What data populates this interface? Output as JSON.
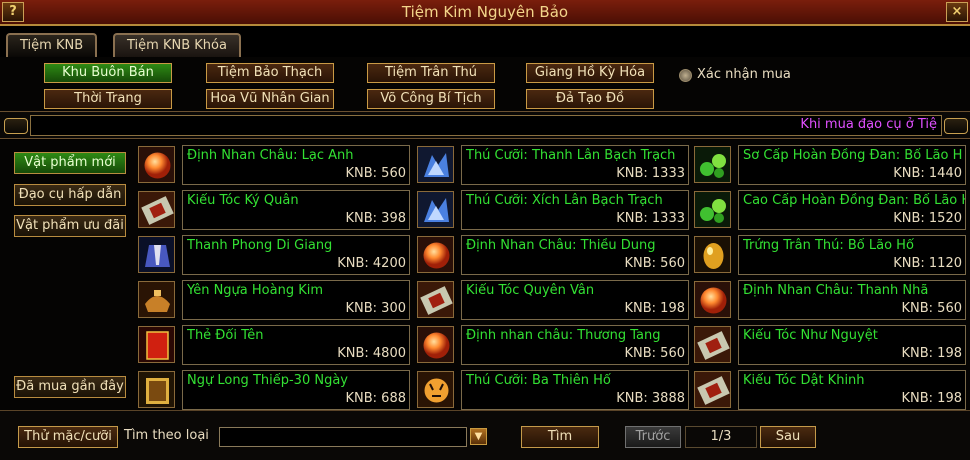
{
  "window": {
    "title": "Tiệm Kim Nguyên Bảo",
    "help_icon": "?",
    "close_icon": "×"
  },
  "tabs": [
    {
      "label": "Tiệm KNB",
      "active": true
    },
    {
      "label": "Tiệm KNB Khóa",
      "active": false
    }
  ],
  "categories": [
    {
      "label": "Khu Buôn Bán",
      "active": true
    },
    {
      "label": "Tiệm Bảo Thạch",
      "active": false
    },
    {
      "label": "Tiệm Trân Thú",
      "active": false
    },
    {
      "label": "Giang Hồ Kỳ Hóa",
      "active": false
    },
    {
      "label": "Thời Trang",
      "active": false
    },
    {
      "label": "Hoa Vũ Nhân Gian",
      "active": false
    },
    {
      "label": "Võ Công Bí Tịch",
      "active": false
    },
    {
      "label": "Đả Tạo Đồ",
      "active": false
    }
  ],
  "confirm_purchase": {
    "label": "Xác nhận mua",
    "checked": false
  },
  "marquee": "Khi mua đạo cụ ở Tiệ",
  "sidebar": [
    {
      "label": "Vật phẩm mới",
      "active": true
    },
    {
      "label": "Đạo cụ hấp dẫn",
      "active": false
    },
    {
      "label": "Vật phẩm ưu đãi",
      "active": false
    },
    {
      "label": "Đã mua gần đây",
      "active": false
    }
  ],
  "items": [
    {
      "name": "Định Nhan Châu: Lạc Anh",
      "price": "KNB: 560",
      "icon": "orb-icon"
    },
    {
      "name": "Thú Cưỡi: Thanh Lân Bạch Trạch",
      "price": "KNB: 1333",
      "icon": "mount-icon"
    },
    {
      "name": "Sơ Cấp Hoàn Đồng Đan: Bố Lão H",
      "price": "KNB: 1440",
      "icon": "pill-icon"
    },
    {
      "name": "Kiểu Tóc Ký Quân",
      "price": "KNB: 398",
      "icon": "scroll-icon"
    },
    {
      "name": "Thú Cưỡi: Xích Lân Bạch Trạch",
      "price": "KNB: 1333",
      "icon": "mount-icon"
    },
    {
      "name": "Cao Cấp Hoàn Đồng Đan: Bố Lão H",
      "price": "KNB: 1520",
      "icon": "pill-icon"
    },
    {
      "name": "Thanh Phong Di Giang",
      "price": "KNB: 4200",
      "icon": "outfit-icon"
    },
    {
      "name": "Định Nhan Châu: Thiều Dung",
      "price": "KNB: 560",
      "icon": "orb-icon"
    },
    {
      "name": "Trứng Trân Thú: Bố Lão Hổ",
      "price": "KNB: 1120",
      "icon": "egg-icon"
    },
    {
      "name": "Yên Ngựa Hoàng Kim",
      "price": "KNB: 300",
      "icon": "saddle-icon"
    },
    {
      "name": "Kiểu Tóc Quyên Vân",
      "price": "KNB: 198",
      "icon": "scroll-icon"
    },
    {
      "name": "Định Nhan Châu: Thanh Nhã",
      "price": "KNB: 560",
      "icon": "orb-icon"
    },
    {
      "name": "Thẻ Đổi Tên",
      "price": "KNB: 4800",
      "icon": "card-icon"
    },
    {
      "name": "Định nhan châu: Thương Tang",
      "price": "KNB: 560",
      "icon": "orb-icon"
    },
    {
      "name": "Kiểu Tóc Như Nguyệt",
      "price": "KNB: 198",
      "icon": "scroll-icon"
    },
    {
      "name": "Ngự Long Thiếp-30 Ngày",
      "price": "KNB: 688",
      "icon": "book-icon"
    },
    {
      "name": "Thú Cưỡi: Ba Thiên Hổ",
      "price": "KNB: 3888",
      "icon": "tiger-icon"
    },
    {
      "name": "Kiểu Tóc Dật Khinh",
      "price": "KNB: 198",
      "icon": "scroll-icon"
    }
  ],
  "bottom": {
    "try_on": "Thử mặc/cưỡi",
    "search_label": "Tìm theo loại",
    "search_value": "",
    "search_button": "Tìm",
    "prev": "Trước",
    "page": "1/3",
    "next": "Sau"
  },
  "colors": {
    "item_name": "#33e033",
    "marquee": "#e050ff",
    "active_button": "#2e8a14"
  }
}
